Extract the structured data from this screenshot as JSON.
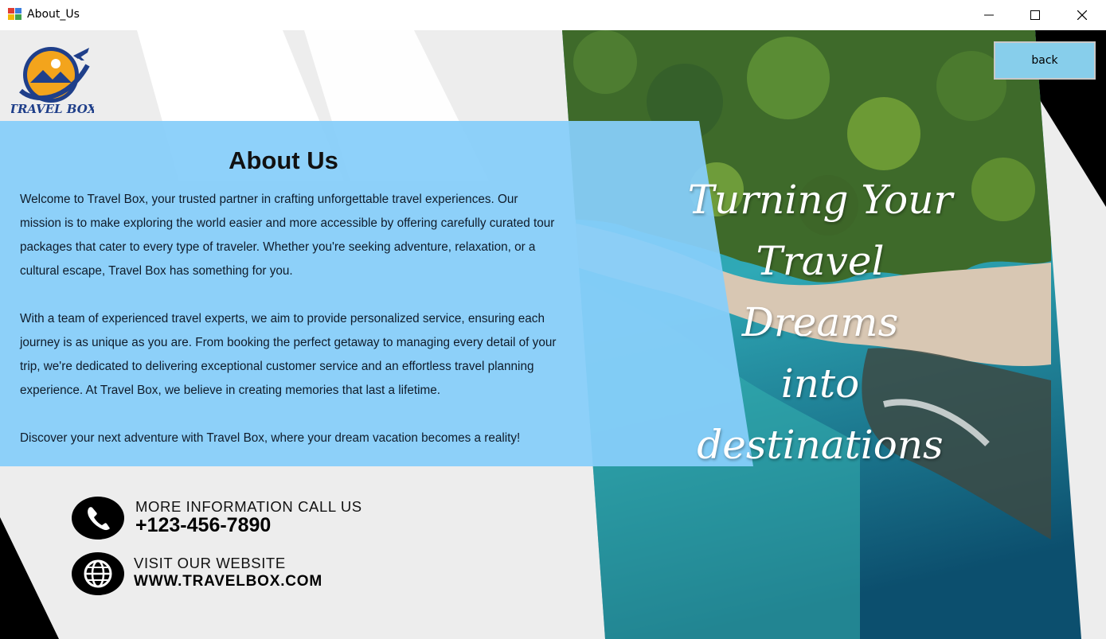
{
  "window": {
    "title": "About_Us",
    "controls": [
      "minimize",
      "maximize",
      "close"
    ]
  },
  "logo": {
    "text": "TRAVEL BOX"
  },
  "back_button": {
    "label": "back"
  },
  "about": {
    "heading": "About Us",
    "paragraphs": [
      "Welcome to Travel Box, your trusted partner in crafting unforgettable travel experiences. Our mission is to make exploring the world easier and more accessible by offering carefully curated tour packages that cater to every type of traveler. Whether you're seeking adventure, relaxation, or a cultural escape, Travel Box has something for you.",
      "With a team of experienced travel experts, we aim to provide personalized service, ensuring each journey is as unique as you are. From booking the perfect getaway to managing every detail of your trip, we're dedicated to delivering exceptional customer service and an effortless travel planning experience. At Travel Box, we believe in creating memories that last a lifetime.",
      "Discover your next adventure with Travel Box, where your dream vacation becomes a reality!"
    ]
  },
  "contact": {
    "phone_label": "MORE INFORMATION CALL US",
    "phone_value": "+123-456-7890",
    "website_label": "VISIT OUR WEBSITE",
    "website_value": "WWW.TRAVELBOX.COM"
  },
  "tagline": [
    "Turning Your",
    "Travel Dreams",
    "into",
    "destinations"
  ],
  "colors": {
    "panel_blue": "#87CEFA",
    "button_blue": "#87CEEB",
    "background_gray": "#EDEDED"
  }
}
